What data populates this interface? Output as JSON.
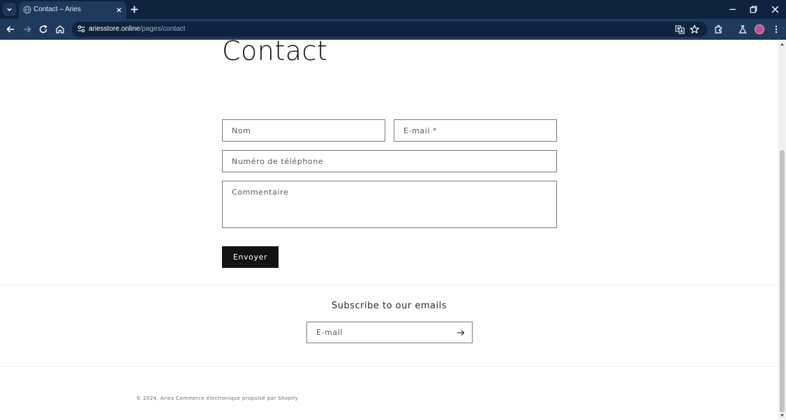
{
  "browser": {
    "tab_title": "Contact – Aries",
    "url_domain": "ariesstore.online",
    "url_path": "/pages/contact",
    "theme_color": "#1e3a5c",
    "icons": [
      "tab-search-icon",
      "globe-icon",
      "close-icon",
      "plus-icon",
      "minimize-icon",
      "restore-icon",
      "close-window-icon",
      "back-icon",
      "forward-icon",
      "reload-icon",
      "home-icon",
      "site-settings-icon",
      "translate-icon",
      "star-icon",
      "extensions-icon",
      "labs-icon",
      "avatar",
      "menu-icon"
    ]
  },
  "page": {
    "title": "Contact",
    "form": {
      "name_placeholder": "Nom",
      "email_placeholder": "E-mail *",
      "phone_placeholder": "Numéro de téléphone",
      "comment_placeholder": "Commentaire",
      "submit_label": "Envoyer"
    },
    "newsletter": {
      "title": "Subscribe to our emails",
      "email_placeholder": "E-mail"
    },
    "footer": {
      "copyright": "© 2024, Aries Commerce électronique propulsé par Shopify"
    }
  },
  "colors": {
    "button_bg": "#121212",
    "text": "#121212"
  }
}
